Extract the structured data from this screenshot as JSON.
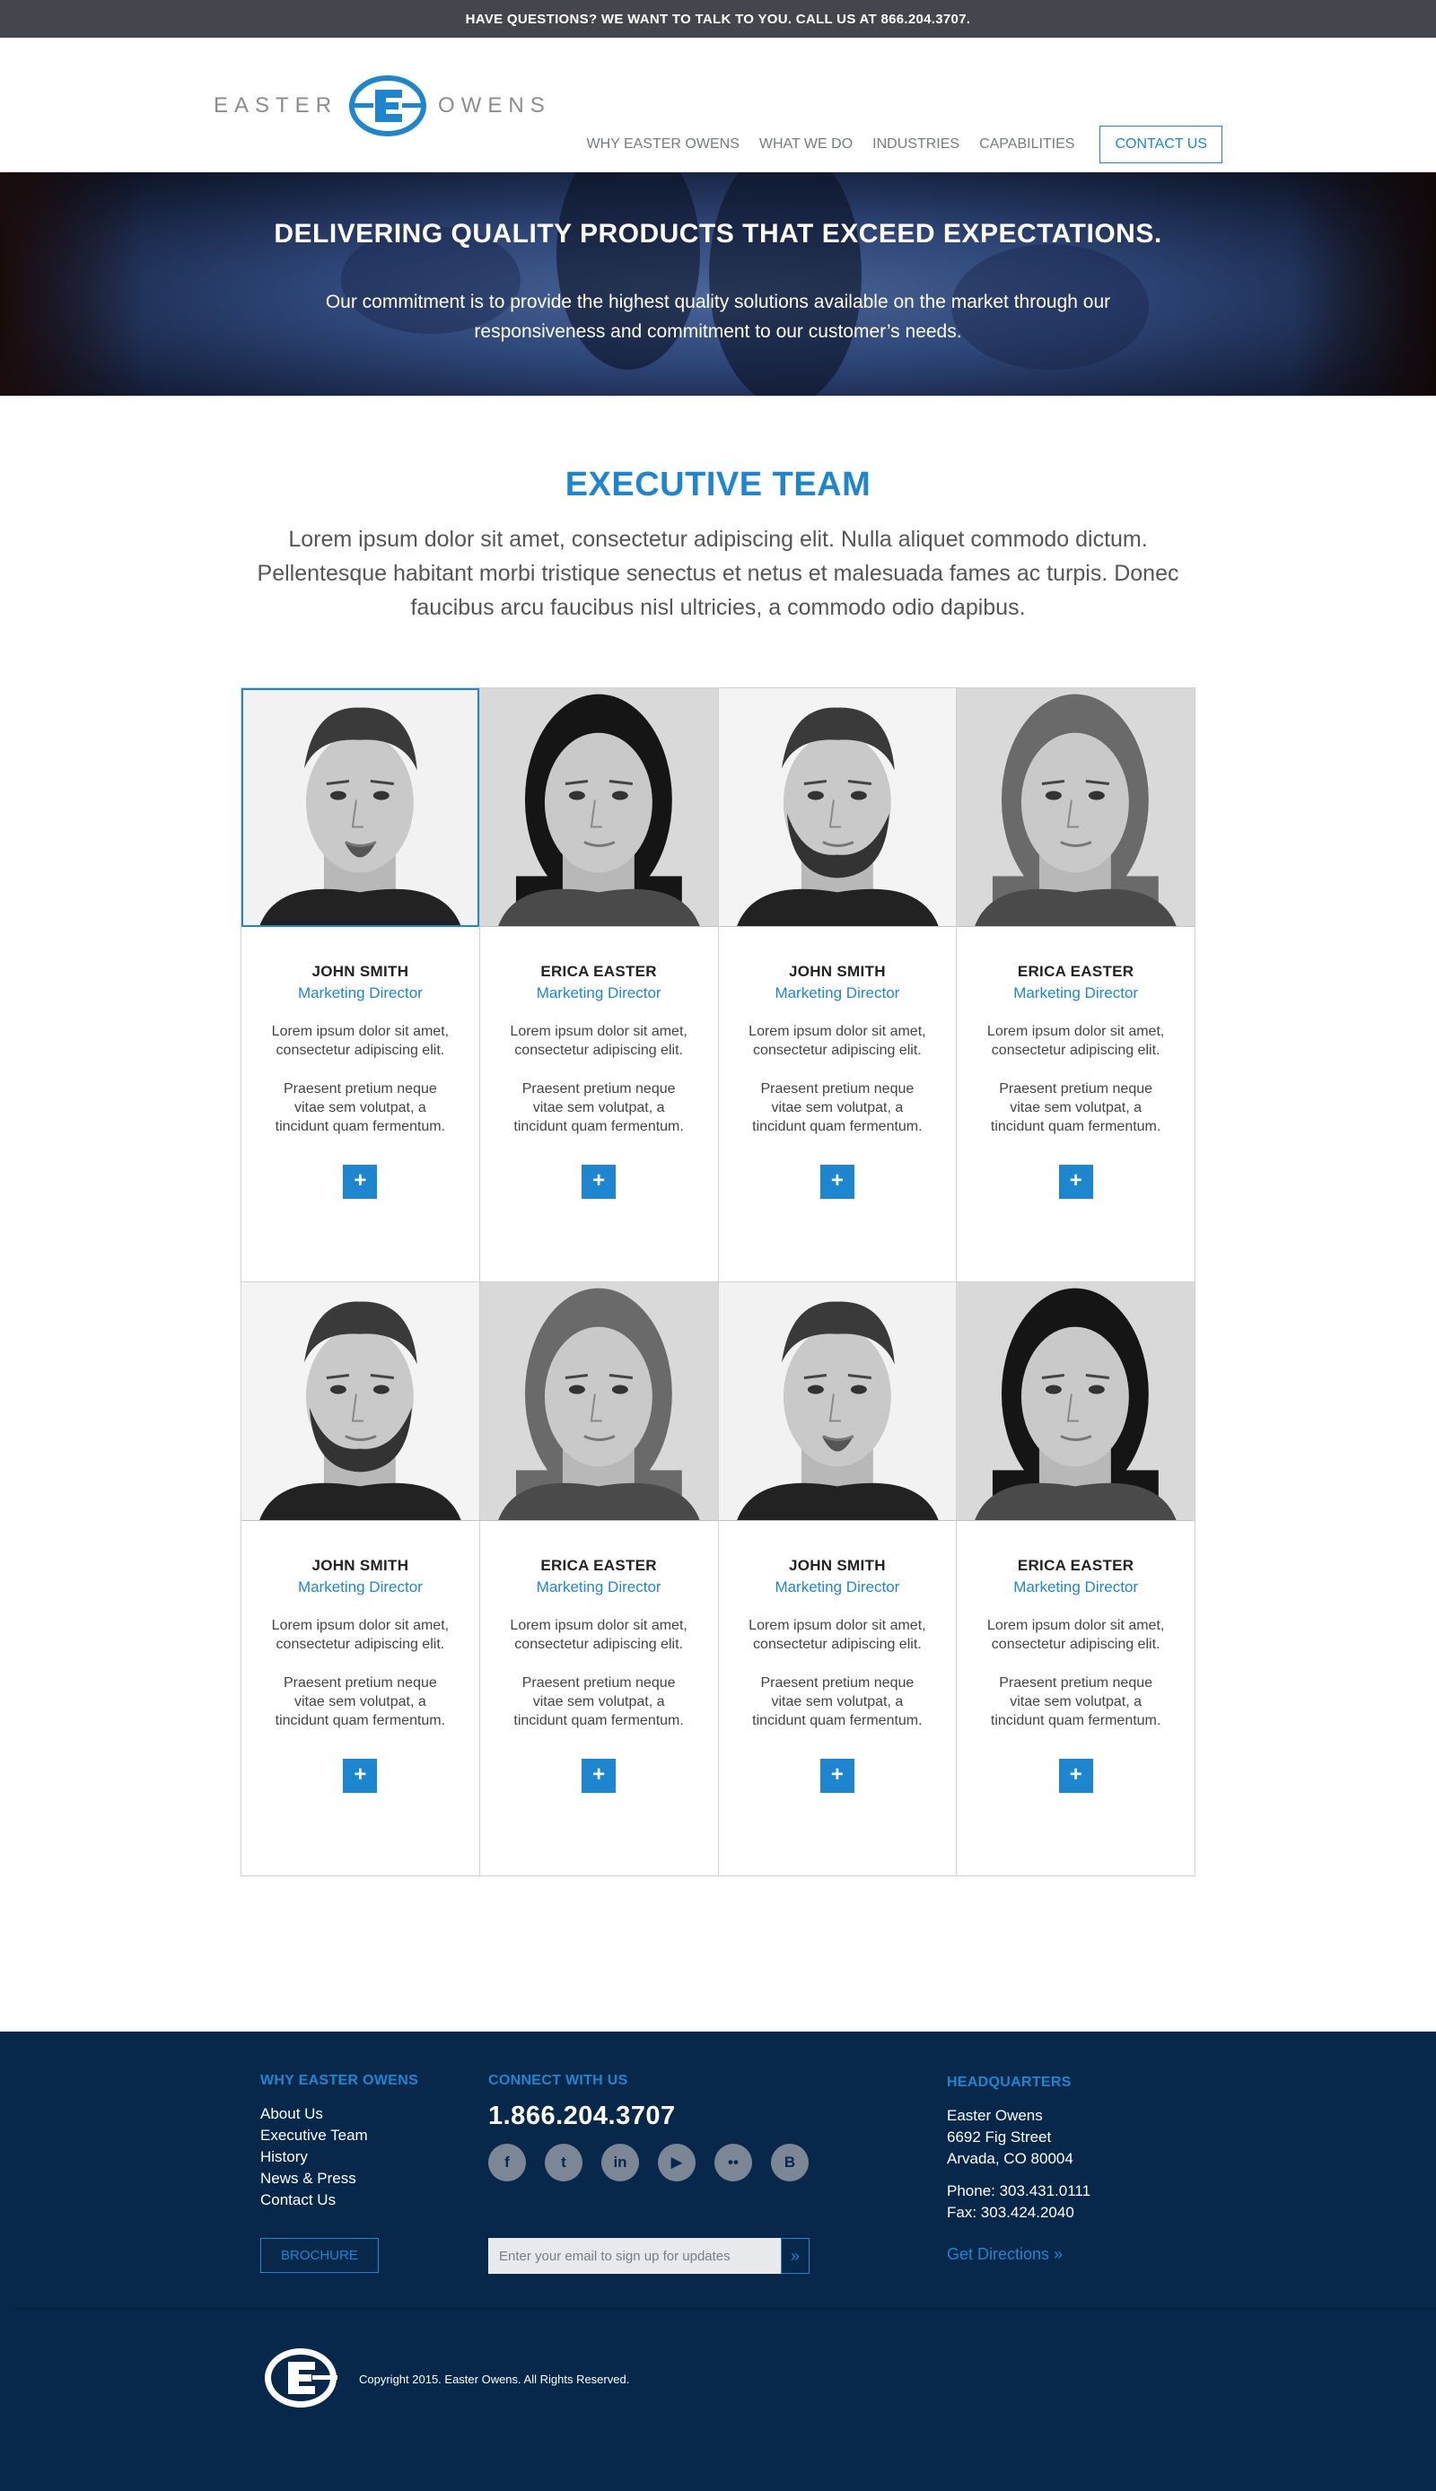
{
  "topbar": {
    "text": "HAVE QUESTIONS? WE WANT TO TALK TO YOU. CALL US AT 866.204.3707."
  },
  "logo": {
    "left_word": "EASTER",
    "right_word": "OWENS",
    "icon": "easter-owens-e-logo"
  },
  "nav": {
    "items": [
      "WHY EASTER OWENS",
      "WHAT WE DO",
      "INDUSTRIES",
      "CAPABILITIES"
    ],
    "contact": "CONTACT US"
  },
  "hero": {
    "title": "DELIVERING QUALITY PRODUCTS THAT EXCEED EXPECTATIONS.",
    "text": "Our commitment is to provide the highest quality solutions available on the market through our responsiveness and commitment to our customer’s needs."
  },
  "team": {
    "title": "EXECUTIVE TEAM",
    "intro": "Lorem ipsum dolor sit amet, consectetur adipiscing elit. Nulla aliquet commodo dictum. Pellentesque habitant morbi tristique senectus et netus et malesuada fames ac turpis. Donec faucibus arcu faucibus nisl ultricies, a commodo odio dapibus.",
    "members": [
      {
        "name": "JOHN SMITH",
        "role": "Marketing Director",
        "p1": "Lorem ipsum dolor sit amet, consectetur adipiscing elit.",
        "p2": "Praesent pretium neque vitae sem volutpat, a tincidunt quam fermentum.",
        "plus": "+",
        "photo": "man-goatee"
      },
      {
        "name": "ERICA EASTER",
        "role": "Marketing Director",
        "p1": "Lorem ipsum dolor sit amet, consectetur adipiscing elit.",
        "p2": "Praesent pretium neque vitae sem volutpat, a tincidunt quam fermentum.",
        "plus": "+",
        "photo": "woman-curly"
      },
      {
        "name": "JOHN SMITH",
        "role": "Marketing Director",
        "p1": "Lorem ipsum dolor sit amet, consectetur adipiscing elit.",
        "p2": "Praesent pretium neque vitae sem volutpat, a tincidunt quam fermentum.",
        "plus": "+",
        "photo": "man-beard"
      },
      {
        "name": "ERICA EASTER",
        "role": "Marketing Director",
        "p1": "Lorem ipsum dolor sit amet, consectetur adipiscing elit.",
        "p2": "Praesent pretium neque vitae sem volutpat, a tincidunt quam fermentum.",
        "plus": "+",
        "photo": "woman-straight"
      },
      {
        "name": "JOHN SMITH",
        "role": "Marketing Director",
        "p1": "Lorem ipsum dolor sit amet, consectetur adipiscing elit.",
        "p2": "Praesent pretium neque vitae sem volutpat, a tincidunt quam fermentum.",
        "plus": "+",
        "photo": "man-beard"
      },
      {
        "name": "ERICA EASTER",
        "role": "Marketing Director",
        "p1": "Lorem ipsum dolor sit amet, consectetur adipiscing elit.",
        "p2": "Praesent pretium neque vitae sem volutpat, a tincidunt quam fermentum.",
        "plus": "+",
        "photo": "woman-straight"
      },
      {
        "name": "JOHN SMITH",
        "role": "Marketing Director",
        "p1": "Lorem ipsum dolor sit amet, consectetur adipiscing elit.",
        "p2": "Praesent pretium neque vitae sem volutpat, a tincidunt quam fermentum.",
        "plus": "+",
        "photo": "man-goatee"
      },
      {
        "name": "ERICA EASTER",
        "role": "Marketing Director",
        "p1": "Lorem ipsum dolor sit amet, consectetur adipiscing elit.",
        "p2": "Praesent pretium neque vitae sem volutpat, a tincidunt quam fermentum.",
        "plus": "+",
        "photo": "woman-curly"
      }
    ]
  },
  "footer": {
    "why": {
      "heading": "WHY EASTER OWENS",
      "links": [
        "About Us",
        "Executive Team",
        "History",
        "News & Press",
        "Contact Us"
      ],
      "brochure": "BROCHURE"
    },
    "connect": {
      "heading": "CONNECT WITH US",
      "phone": "1.866.204.3707",
      "socials": [
        {
          "icon": "facebook-icon",
          "glyph": "f"
        },
        {
          "icon": "twitter-icon",
          "glyph": "t"
        },
        {
          "icon": "linkedin-icon",
          "glyph": "in"
        },
        {
          "icon": "youtube-icon",
          "glyph": "▶"
        },
        {
          "icon": "flickr-icon",
          "glyph": "••"
        },
        {
          "icon": "blogger-icon",
          "glyph": "B"
        }
      ],
      "signup_placeholder": "Enter your email to sign up for updates",
      "signup_button": "»"
    },
    "hq": {
      "heading": "HEADQUARTERS",
      "address": [
        "Easter Owens",
        "6692 Fig Street",
        "Arvada, CO 80004"
      ],
      "contact": [
        "Phone: 303.431.0111",
        "Fax: 303.424.2040"
      ],
      "directions": "Get Directions »"
    },
    "copyright": "Copyright 2015. Easter Owens. All Rights Reserved."
  },
  "colors": {
    "accent": "#1e86cf",
    "footer_bg": "#07284a",
    "topbar_bg": "#45464d"
  }
}
